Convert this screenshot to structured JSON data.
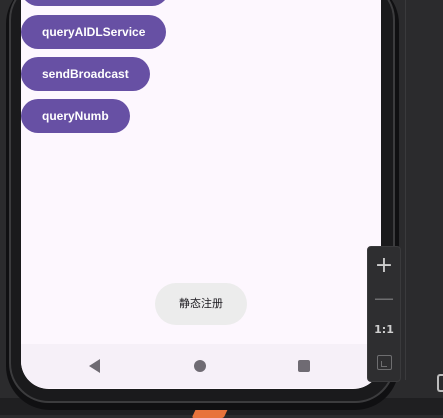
{
  "app": {
    "buttons": [
      {
        "label": "queryAIDLService"
      },
      {
        "label": "sendBroadcast"
      },
      {
        "label": "queryNumb"
      }
    ],
    "toast": "静态注册"
  },
  "zoom_controls": {
    "zoom_in": "+",
    "zoom_out": "—",
    "actual_size": "1:1"
  },
  "colors": {
    "button_bg": "#6750a4",
    "screen_bg": "#fdf7fe",
    "accent_tab": "#e8733b"
  }
}
